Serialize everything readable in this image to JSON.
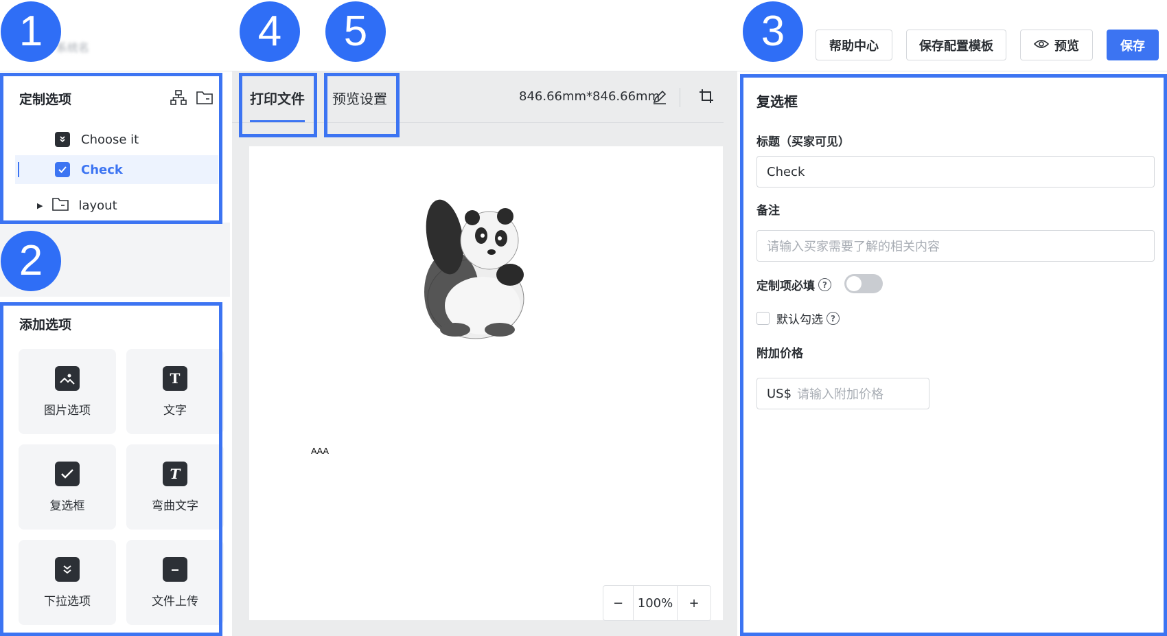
{
  "markers": [
    "1",
    "2",
    "3",
    "4",
    "5"
  ],
  "topbar": {
    "blurred_title": "系统名",
    "help": "帮助中心",
    "save_template": "保存配置模板",
    "preview": "预览",
    "save": "保存"
  },
  "customize": {
    "title": "定制选项",
    "items": [
      {
        "label": "Choose it",
        "icon": "dropdown-chip-icon"
      },
      {
        "label": "Check",
        "icon": "checkbox-chip-icon",
        "selected": true
      },
      {
        "label": "layout",
        "icon": "folder-icon",
        "collapsed": true
      }
    ]
  },
  "add_options": {
    "title": "添加选项",
    "tiles": [
      {
        "label": "图片选项",
        "icon": "image-icon"
      },
      {
        "label": "文字",
        "icon": "text-icon"
      },
      {
        "label": "复选框",
        "icon": "checkbox-icon"
      },
      {
        "label": "弯曲文字",
        "icon": "curved-text-icon"
      },
      {
        "label": "下拉选项",
        "icon": "dropdown-icon"
      },
      {
        "label": "文件上传",
        "icon": "folder-upload-icon"
      }
    ]
  },
  "center": {
    "tabs": [
      "打印文件",
      "预览设置"
    ],
    "active_tab": "打印文件",
    "dimension": "846.66mm*846.66mm",
    "canvas_text": "AAA",
    "zoom": "100%",
    "zoom_out": "−",
    "zoom_in": "+"
  },
  "right": {
    "title": "复选框",
    "title_label": "标题（买家可见）",
    "title_value": "Check",
    "note_label": "备注",
    "note_placeholder": "请输入买家需要了解的相关内容",
    "required_label": "定制项必填",
    "required_on": false,
    "default_checked_label": "默认勾选",
    "default_checked": false,
    "price_label": "附加价格",
    "price_prefix": "US$",
    "price_placeholder": "请输入附加价格"
  },
  "colors": {
    "accent": "#3c74f2",
    "marker": "#2f6ef6"
  }
}
